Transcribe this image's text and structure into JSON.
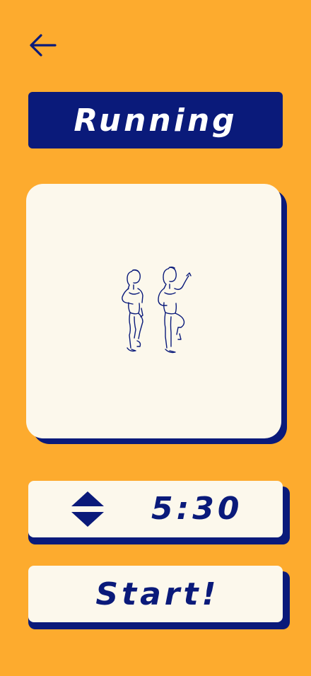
{
  "header": {
    "back_icon": "arrow-left-icon",
    "title": "Running"
  },
  "exercise": {
    "illustration": "running-in-place-illustration"
  },
  "timer": {
    "stepper_icon": "up-down-stepper-icon",
    "value": "5:30"
  },
  "actions": {
    "start_label": "Start!"
  },
  "colors": {
    "background": "#FDAB2E",
    "accent": "#0A1A7A",
    "card": "#FCF8EC"
  }
}
